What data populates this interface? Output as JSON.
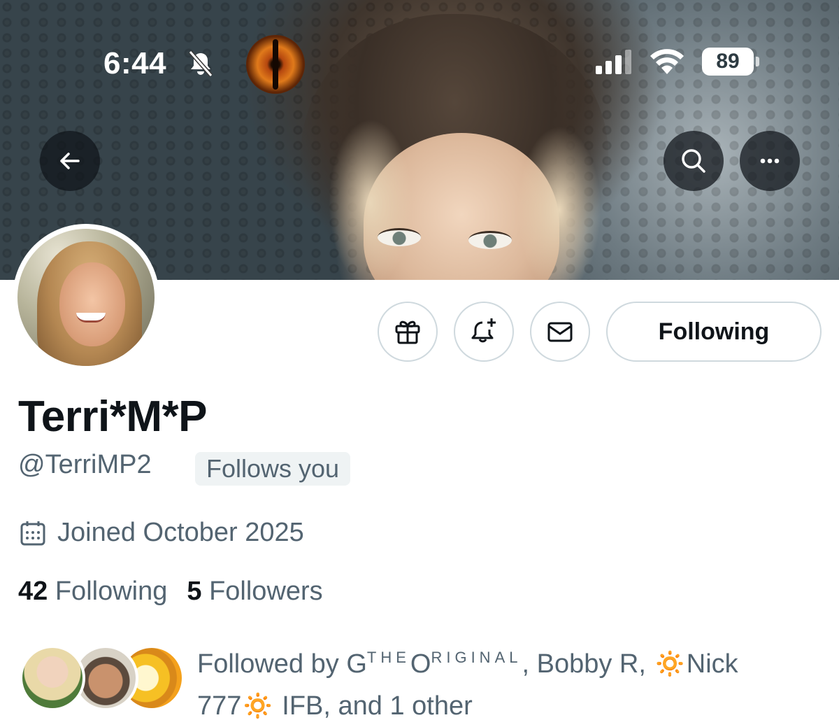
{
  "status_bar": {
    "time": "6:44",
    "battery": "89",
    "icons": [
      "bell-slash-icon",
      "cellular-signal-icon",
      "wifi-icon",
      "battery-icon"
    ]
  },
  "header": {
    "back_icon": "arrow-left-icon",
    "search_icon": "search-icon",
    "more_icon": "ellipsis-icon"
  },
  "actions": {
    "gift_icon": "gift-icon",
    "notify_icon": "bell-plus-icon",
    "message_icon": "envelope-icon",
    "following_label": "Following"
  },
  "profile": {
    "name": "Terri*M*P",
    "handle": "@TerriMP2",
    "follows_you": "Follows you",
    "joined": "Joined October 2025",
    "following_count": "42",
    "following_label": "Following",
    "followers_count": "5",
    "followers_label": "Followers"
  },
  "followed_by": {
    "prefix": "Followed by ",
    "name1_g": "G",
    "name1_the": "THE",
    "name1_o": "O",
    "name1_riginal": "RIGINAL",
    "rest_line1": ", Bobby R, 🔅Nick",
    "rest_line2": "777🔅 IFB, and 1 other"
  },
  "colors": {
    "text_primary": "#0f1419",
    "text_secondary": "#536471",
    "border": "#cfd9de",
    "badge_bg": "#eff3f4"
  }
}
